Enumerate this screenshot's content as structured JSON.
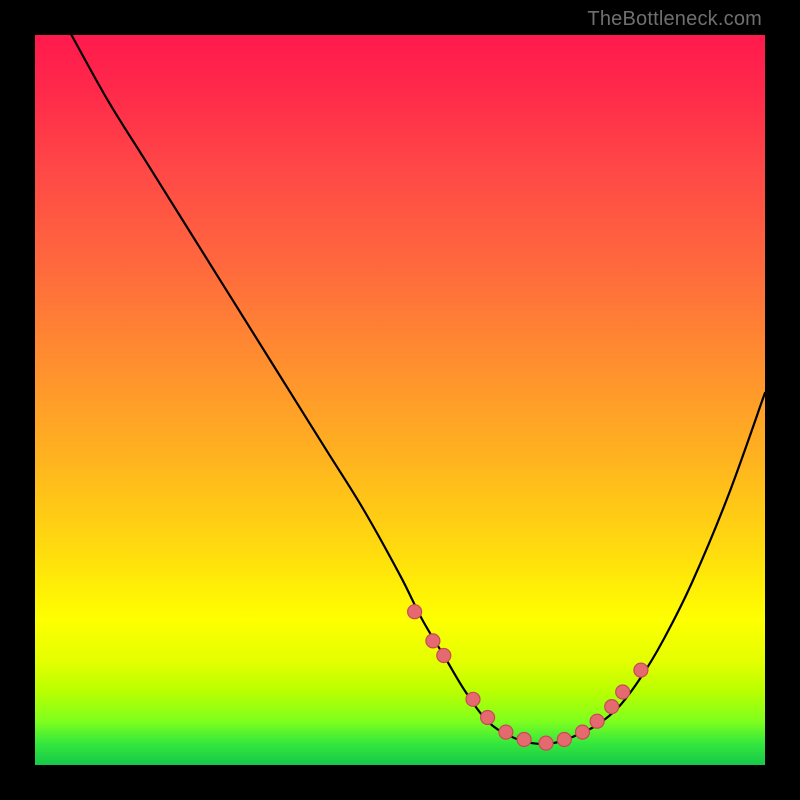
{
  "credit": "TheBottleneck.com",
  "colors": {
    "marker_fill": "#e46a6f",
    "marker_stroke": "#c94a55",
    "curve": "#000000"
  },
  "chart_data": {
    "type": "line",
    "title": "",
    "xlabel": "",
    "ylabel": "",
    "xlim": [
      0,
      100
    ],
    "ylim": [
      0,
      100
    ],
    "annotations": [
      "TheBottleneck.com"
    ],
    "series": [
      {
        "name": "curve",
        "x": [
          5,
          10,
          15,
          20,
          25,
          30,
          35,
          40,
          45,
          50,
          53,
          56,
          59,
          62,
          65,
          68,
          71,
          74,
          77,
          80,
          83,
          86,
          90,
          95,
          100
        ],
        "y": [
          100,
          91,
          83,
          75,
          67,
          59,
          51,
          43,
          35,
          26,
          20,
          15,
          10,
          6,
          4,
          3,
          3,
          4,
          5.5,
          8,
          12,
          17,
          25,
          37,
          51
        ]
      }
    ],
    "markers": {
      "name": "dots",
      "x": [
        52,
        54.5,
        56,
        60,
        62,
        64.5,
        67,
        70,
        72.5,
        75,
        77,
        79,
        80.5,
        83
      ],
      "y": [
        21,
        17,
        15,
        9,
        6.5,
        4.5,
        3.5,
        3,
        3.5,
        4.5,
        6,
        8,
        10,
        13
      ]
    }
  }
}
